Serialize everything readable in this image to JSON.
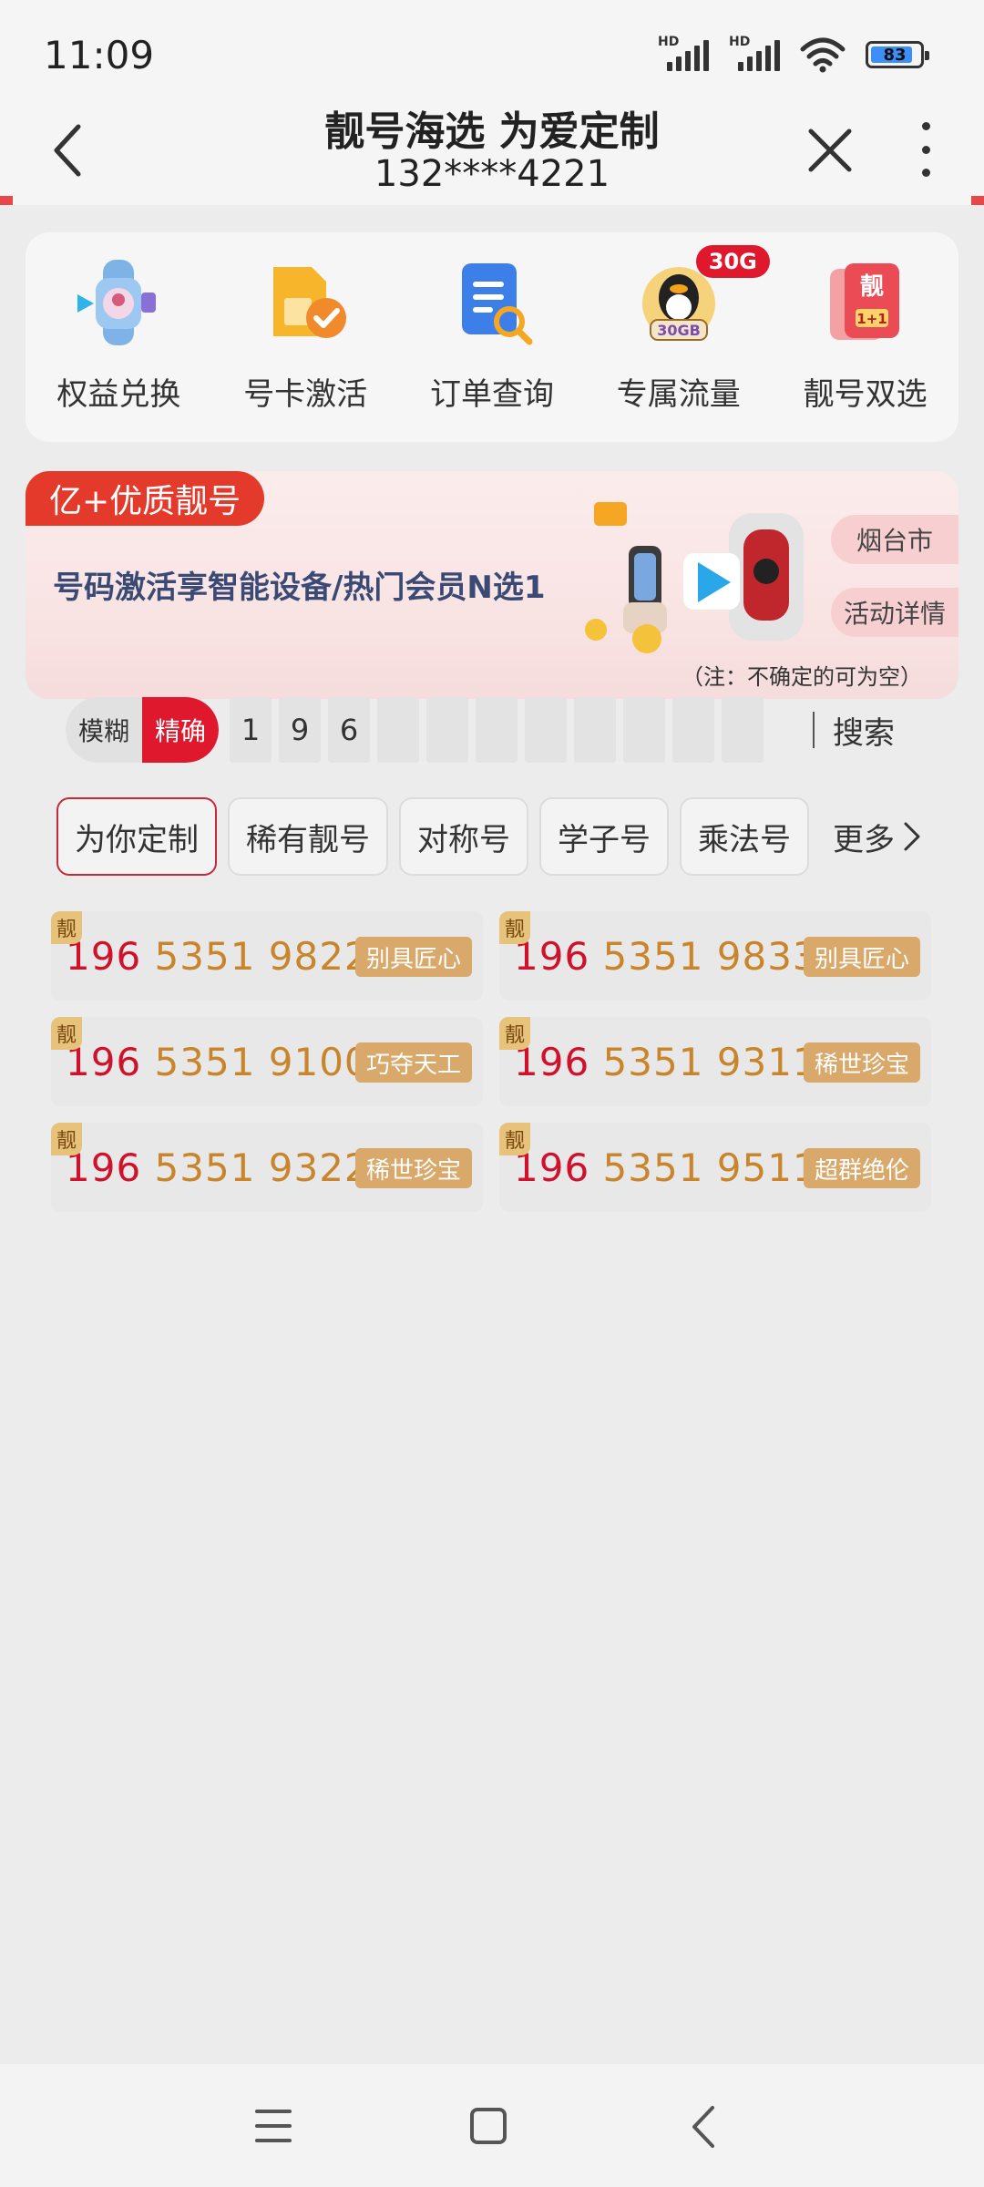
{
  "status": {
    "time": "11:09",
    "battery": "83",
    "signal1": "HD",
    "signal2": "HD"
  },
  "header": {
    "title": "靓号海选 为爱定制",
    "subtitle": "132****4221"
  },
  "quick_links": [
    {
      "label": "权益兑换",
      "icon": "watch-gift-icon"
    },
    {
      "label": "号卡激活",
      "icon": "sim-card-check-icon"
    },
    {
      "label": "订单查询",
      "icon": "order-search-icon"
    },
    {
      "label": "专属流量",
      "icon": "qq-penguin-icon",
      "badge": "30G"
    },
    {
      "label": "靓号双选",
      "icon": "double-number-icon"
    }
  ],
  "banner": {
    "tag": "亿+优质靓号",
    "text": "号码激活享智能设备/热门会员N选1",
    "city": "烟台市",
    "detail": "活动详情",
    "note": "（注：不确定的可为空）"
  },
  "search": {
    "mode_fuzzy": "模糊",
    "mode_exact": "精确",
    "digits": [
      "1",
      "9",
      "6",
      "",
      "",
      "",
      "",
      "",
      "",
      "",
      ""
    ],
    "button": "搜索"
  },
  "tabs": [
    "为你定制",
    "稀有靓号",
    "对称号",
    "学子号",
    "乘法号",
    "更多"
  ],
  "numbers": [
    {
      "prefix": "196",
      "rest": "5351 9822",
      "tag": "别具匠心",
      "mark": "靓"
    },
    {
      "prefix": "196",
      "rest": "5351 9833",
      "tag": "别具匠心",
      "mark": "靓"
    },
    {
      "prefix": "196",
      "rest": "5351 9100",
      "tag": "巧夺天工",
      "mark": "靓"
    },
    {
      "prefix": "196",
      "rest": "5351 9311",
      "tag": "稀世珍宝",
      "mark": "靓"
    },
    {
      "prefix": "196",
      "rest": "5351 9322",
      "tag": "稀世珍宝",
      "mark": "靓"
    },
    {
      "prefix": "196",
      "rest": "5351 9511",
      "tag": "超群绝伦",
      "mark": "靓"
    }
  ],
  "colors": {
    "accent": "#e0182e",
    "gold": "#c9852b",
    "tag_bg": "#d9a86b"
  }
}
